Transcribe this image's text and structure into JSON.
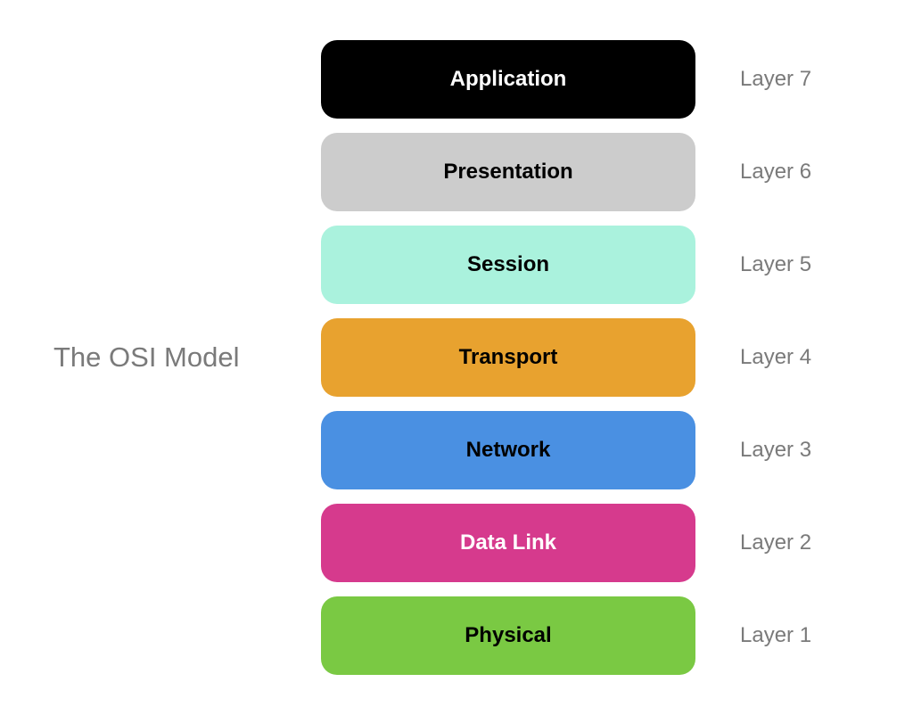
{
  "title": "The OSI Model",
  "layers": [
    {
      "name": "Application",
      "label": "Layer 7",
      "bg": "#000000",
      "fg": "#ffffff"
    },
    {
      "name": "Presentation",
      "label": "Layer 6",
      "bg": "#cccccc",
      "fg": "#000000"
    },
    {
      "name": "Session",
      "label": "Layer 5",
      "bg": "#aaf2dd",
      "fg": "#000000"
    },
    {
      "name": "Transport",
      "label": "Layer 4",
      "bg": "#e8a22f",
      "fg": "#000000"
    },
    {
      "name": "Network",
      "label": "Layer 3",
      "bg": "#4a90e2",
      "fg": "#000000"
    },
    {
      "name": "Data Link",
      "label": "Layer 2",
      "bg": "#d63a8d",
      "fg": "#ffffff"
    },
    {
      "name": "Physical",
      "label": "Layer 1",
      "bg": "#7ac943",
      "fg": "#000000"
    }
  ]
}
